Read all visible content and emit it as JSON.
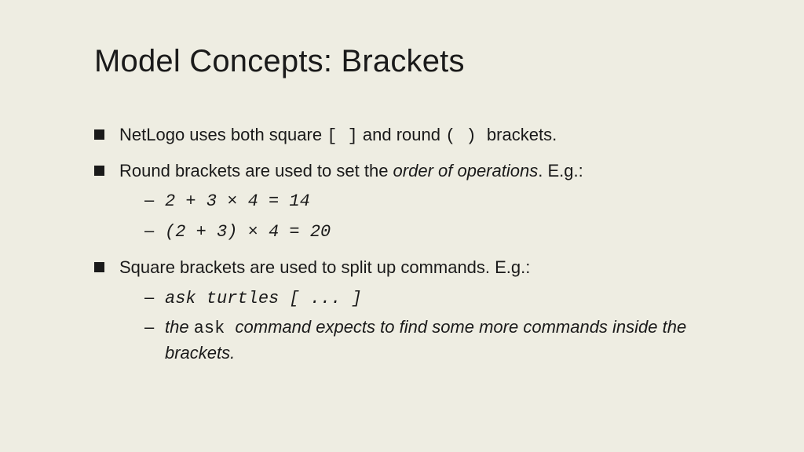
{
  "title": "Model Concepts: Brackets",
  "bullets": {
    "b1": {
      "t1": "NetLogo uses both square ",
      "code1": "[ ]",
      "t2": " and round ",
      "code2": "( ) ",
      "t3": " brackets."
    },
    "b2": {
      "t1": "Round brackets are used to set the ",
      "em": "order of operations",
      "t2": ". E.g.:",
      "sub1": " 2 + 3  × 4 = 14",
      "sub2": "(2 + 3) × 4 = 20"
    },
    "b3": {
      "t1": "Square brackets are used to split up commands. E.g.:",
      "sub1": "ask turtles [ ... ]",
      "sub2a": "the ",
      "sub2code": "ask ",
      "sub2b": " command expects to find some more commands inside the brackets."
    }
  }
}
